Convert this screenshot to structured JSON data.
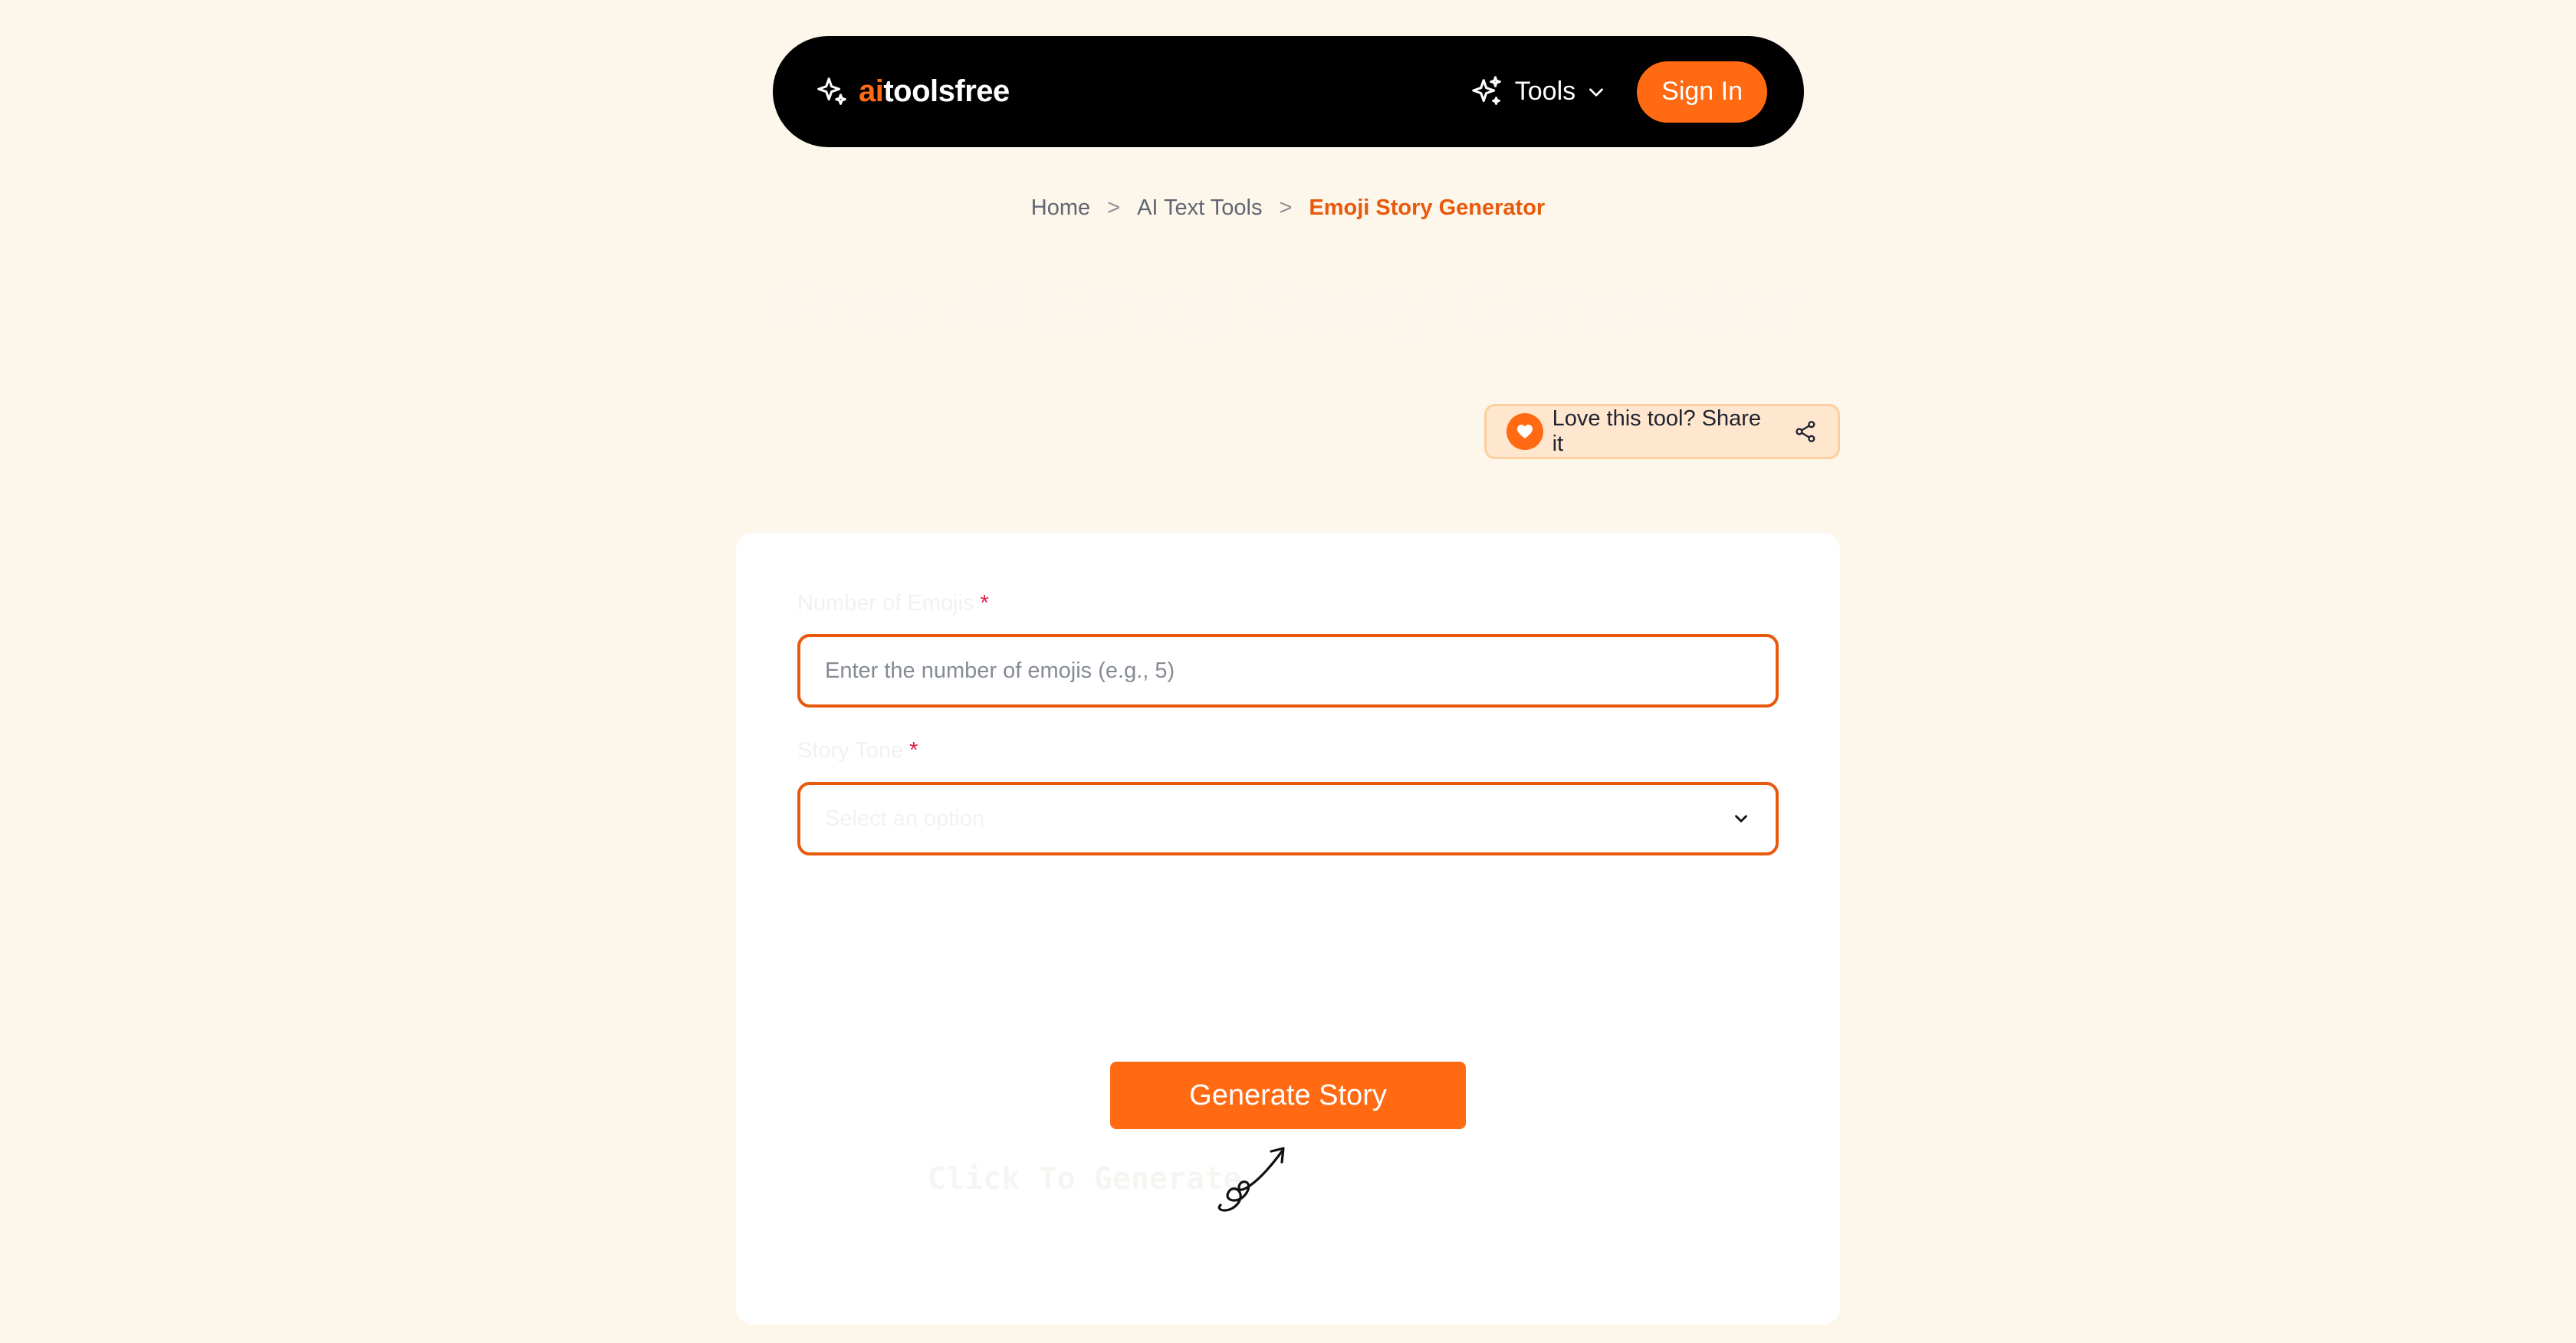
{
  "navbar": {
    "logo_ai": "ai",
    "logo_rest": "toolsfree",
    "tools_label": "Tools",
    "signin_label": "Sign In"
  },
  "breadcrumb": {
    "items": [
      "Home",
      "AI Text Tools"
    ],
    "separator": ">",
    "current": "Emoji Story Generator"
  },
  "page": {
    "title": "Free AI Emoji Story Generator"
  },
  "share": {
    "label": "Love this tool? Share it"
  },
  "form": {
    "emoji_count": {
      "label": "Number of Emojis",
      "required_mark": "*",
      "placeholder": "Enter the number of emojis (e.g., 5)",
      "value": ""
    },
    "story_tone": {
      "label": "Story Tone",
      "required_mark": "*",
      "placeholder": "Select an option"
    },
    "generate_label": "Generate Story",
    "click_hint": "Click To Generate"
  },
  "colors": {
    "accent": "#ff6a13",
    "accent_dark": "#e8590c",
    "background": "#fdf6ea",
    "navbar": "#000000"
  },
  "icons": [
    "sparkle-icon",
    "chevron-down-icon",
    "heart-icon",
    "share-icon",
    "arrow-doodle-icon"
  ]
}
